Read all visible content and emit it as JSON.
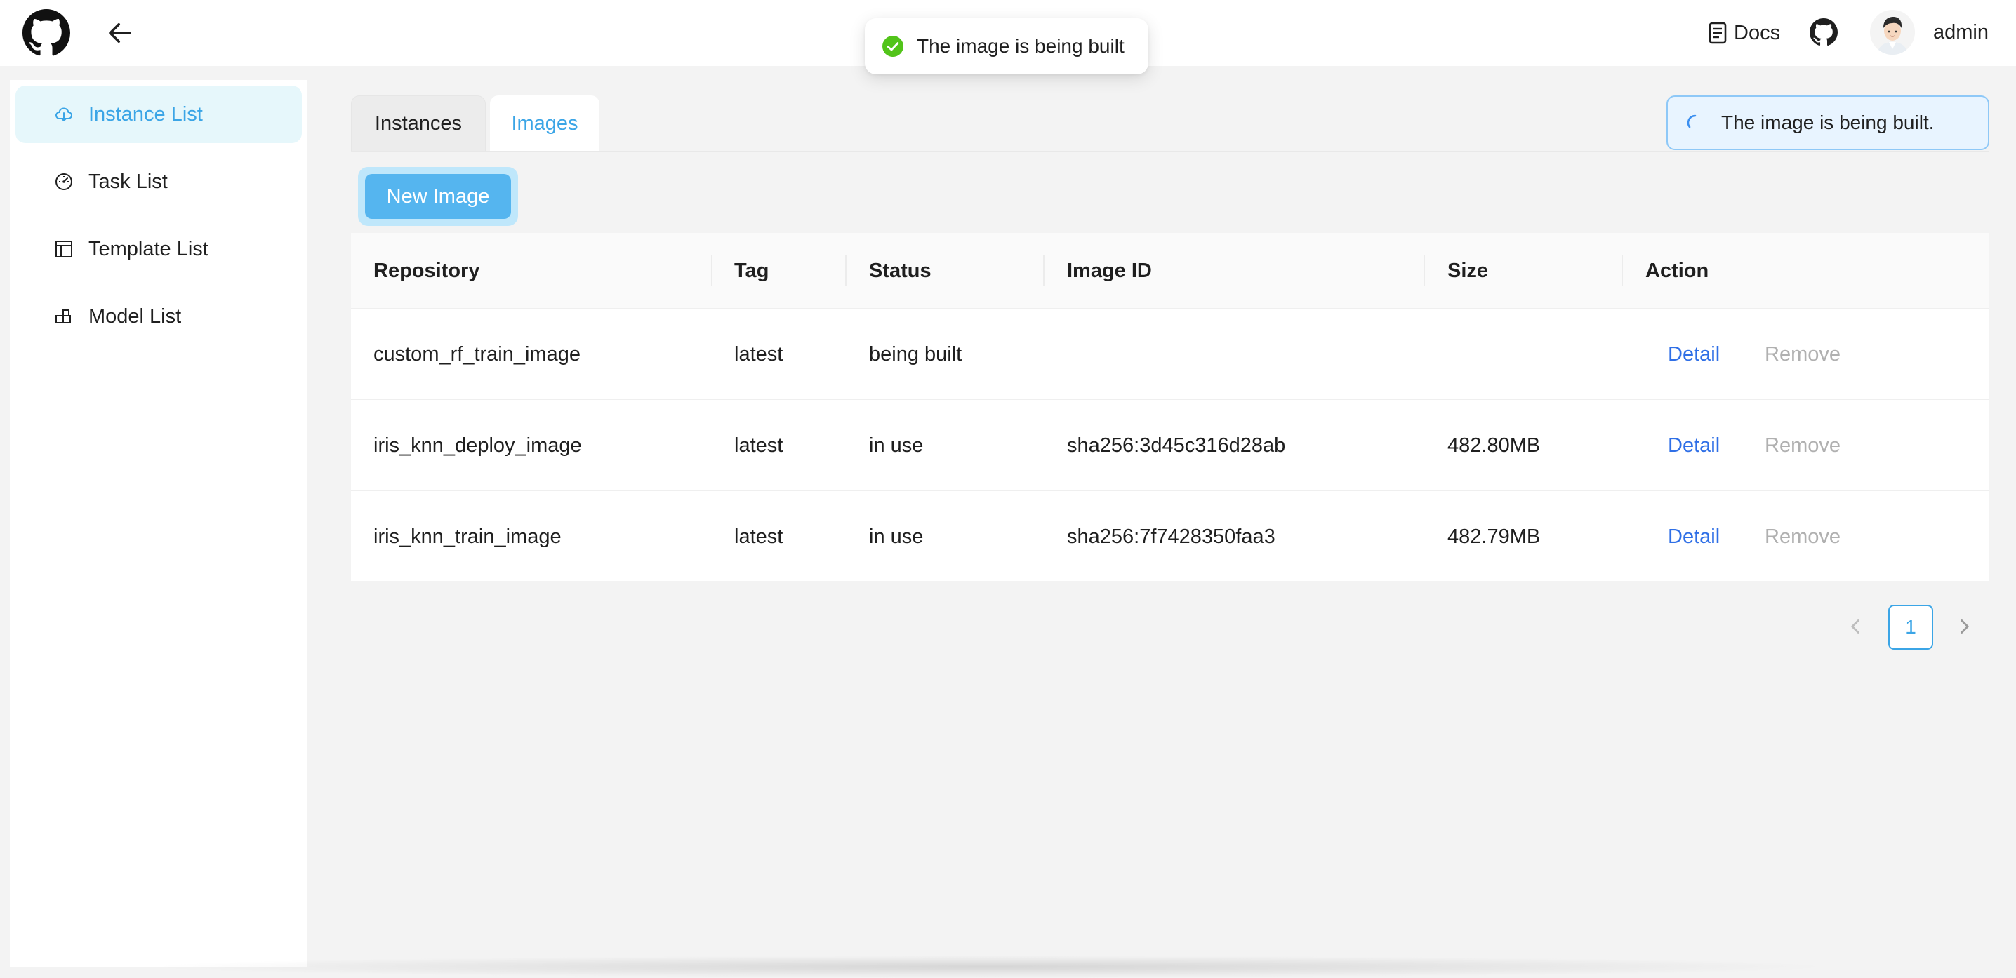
{
  "header": {
    "docs_label": "Docs",
    "user_name": "admin",
    "logo_icon": "github-logo-icon",
    "back_icon": "arrow-left-icon"
  },
  "toast": {
    "message": "The image is being built",
    "icon": "check-circle-icon",
    "icon_color": "#52c41a"
  },
  "sidebar": {
    "items": [
      {
        "label": "Instance List",
        "icon": "cloud-icon",
        "active": true
      },
      {
        "label": "Task List",
        "icon": "dashboard-icon",
        "active": false
      },
      {
        "label": "Template List",
        "icon": "layout-icon",
        "active": false
      },
      {
        "label": "Model List",
        "icon": "blocks-icon",
        "active": false
      }
    ]
  },
  "tabs": [
    {
      "label": "Instances",
      "active": false
    },
    {
      "label": "Images",
      "active": true
    }
  ],
  "alert": {
    "message": "The image is being built.",
    "icon": "loading-spinner-icon"
  },
  "toolbar": {
    "new_image_label": "New Image"
  },
  "table": {
    "columns": [
      "Repository",
      "Tag",
      "Status",
      "Image ID",
      "Size",
      "Action"
    ],
    "rows": [
      {
        "repository": "custom_rf_train_image",
        "tag": "latest",
        "status": "being built",
        "image_id": "",
        "size": "",
        "detail": "Detail",
        "remove": "Remove"
      },
      {
        "repository": "iris_knn_deploy_image",
        "tag": "latest",
        "status": "in use",
        "image_id": "sha256:3d45c316d28ab",
        "size": "482.80MB",
        "detail": "Detail",
        "remove": "Remove"
      },
      {
        "repository": "iris_knn_train_image",
        "tag": "latest",
        "status": "in use",
        "image_id": "sha256:7f7428350faa3",
        "size": "482.79MB",
        "detail": "Detail",
        "remove": "Remove"
      }
    ]
  },
  "pagination": {
    "current_page": "1"
  },
  "colors": {
    "accent": "#3ba5e6",
    "link": "#2f6fe6",
    "disabled": "#b0b0b0",
    "button": "#55b5ef"
  }
}
